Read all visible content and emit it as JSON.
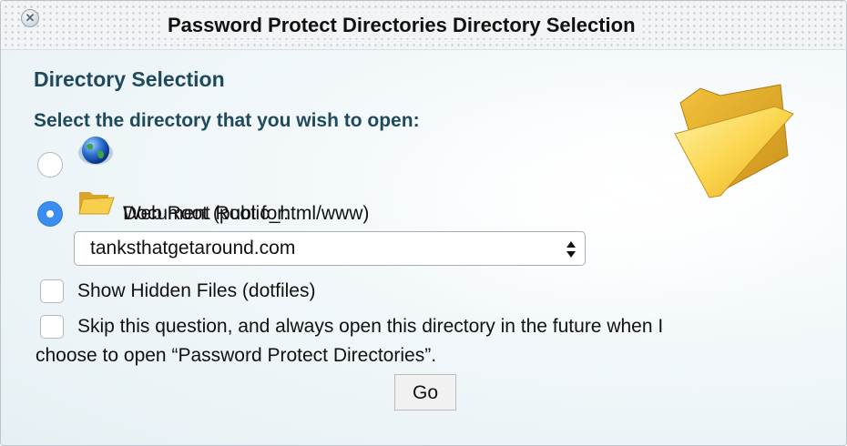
{
  "dialog": {
    "title": "Password Protect Directories Directory Selection",
    "close_icon": "close-icon"
  },
  "content": {
    "heading": "Directory Selection",
    "prompt": "Select the directory that you wish to open:",
    "options": [
      {
        "label": "Web Root (public_html/www)",
        "icon": "globe-icon",
        "selected": false
      },
      {
        "label": "Document Root for:",
        "icon": "folder-icon",
        "selected": true
      }
    ],
    "domain_select": {
      "value": "tanksthatgetaround.com"
    },
    "show_hidden": {
      "label": "Show Hidden Files (dotfiles)",
      "checked": false
    },
    "skip_question": {
      "label_line1": "Skip this question, and always open this directory in the future when I",
      "label_line2": "choose to open “Password Protect Directories”.",
      "checked": false
    },
    "go_button": "Go"
  },
  "colors": {
    "heading": "#1f4a5e",
    "radio_selected": "#3b8ef0"
  }
}
